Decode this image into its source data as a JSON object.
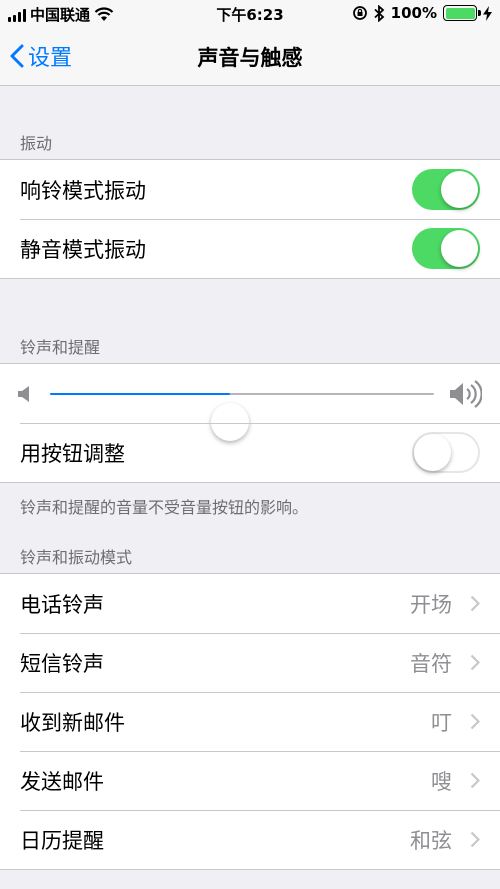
{
  "status_bar": {
    "carrier": "中国联通",
    "time": "下午6:23",
    "battery_percent": "100%",
    "battery_level": 1.0
  },
  "nav": {
    "back_label": "设置",
    "title": "声音与触感"
  },
  "vibration": {
    "header": "振动",
    "rows": [
      {
        "label": "响铃模式振动",
        "on": true
      },
      {
        "label": "静音模式振动",
        "on": true
      }
    ]
  },
  "ringer": {
    "header": "铃声和提醒",
    "volume_level": 0.47,
    "button_adjust_label": "用按钮调整",
    "button_adjust_on": false,
    "footnote": "铃声和提醒的音量不受音量按钮的影响。"
  },
  "patterns": {
    "header": "铃声和振动模式",
    "rows": [
      {
        "label": "电话铃声",
        "value": "开场"
      },
      {
        "label": "短信铃声",
        "value": "音符"
      },
      {
        "label": "收到新邮件",
        "value": "叮"
      },
      {
        "label": "发送邮件",
        "value": "嗖"
      },
      {
        "label": "日历提醒",
        "value": "和弦"
      }
    ]
  },
  "colors": {
    "accent": "#007aff",
    "toggle_on": "#4cd964",
    "background": "#efeff4"
  }
}
